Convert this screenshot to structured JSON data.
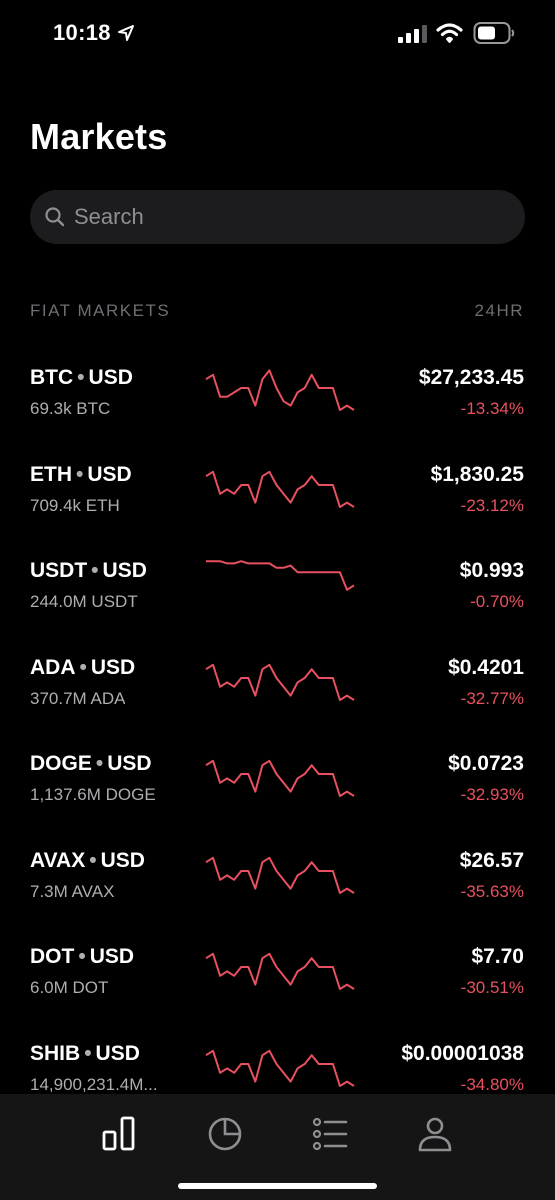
{
  "status_bar": {
    "time": "10:18"
  },
  "page": {
    "title": "Markets"
  },
  "search": {
    "placeholder": "Search"
  },
  "section": {
    "label": "FIAT MARKETS",
    "period": "24HR"
  },
  "colors": {
    "negative": "#e8515f",
    "background": "#000000",
    "tab_bar": "#151515"
  },
  "markets": [
    {
      "base": "BTC",
      "quote": "USD",
      "volume": "69.3k BTC",
      "price": "$27,233.45",
      "change": "-13.34%",
      "trend": [
        0.3,
        0.2,
        0.7,
        0.7,
        0.6,
        0.5,
        0.5,
        0.9,
        0.3,
        0.1,
        0.5,
        0.8,
        0.9,
        0.6,
        0.5,
        0.2,
        0.5,
        0.5,
        0.5,
        1,
        0.9,
        1
      ]
    },
    {
      "base": "ETH",
      "quote": "USD",
      "volume": "709.4k ETH",
      "price": "$1,830.25",
      "change": "-23.12%",
      "trend": [
        0.3,
        0.2,
        0.7,
        0.6,
        0.7,
        0.5,
        0.5,
        0.9,
        0.3,
        0.2,
        0.5,
        0.7,
        0.9,
        0.6,
        0.5,
        0.3,
        0.5,
        0.5,
        0.5,
        1,
        0.9,
        1
      ]
    },
    {
      "base": "USDT",
      "quote": "USD",
      "volume": "244.0M USDT",
      "price": "$0.993",
      "change": "-0.70%",
      "trend": [
        0.05,
        0.05,
        0.05,
        0.1,
        0.1,
        0.05,
        0.1,
        0.1,
        0.1,
        0.1,
        0.2,
        0.2,
        0.15,
        0.3,
        0.3,
        0.3,
        0.3,
        0.3,
        0.3,
        0.3,
        0.7,
        0.6
      ]
    },
    {
      "base": "ADA",
      "quote": "USD",
      "volume": "370.7M ADA",
      "price": "$0.4201",
      "change": "-32.77%",
      "trend": [
        0.3,
        0.2,
        0.7,
        0.6,
        0.7,
        0.5,
        0.5,
        0.9,
        0.3,
        0.2,
        0.5,
        0.7,
        0.9,
        0.6,
        0.5,
        0.3,
        0.5,
        0.5,
        0.5,
        1,
        0.9,
        1
      ]
    },
    {
      "base": "DOGE",
      "quote": "USD",
      "volume": "1,137.6M DOGE",
      "price": "$0.0723",
      "change": "-32.93%",
      "trend": [
        0.3,
        0.2,
        0.7,
        0.6,
        0.7,
        0.5,
        0.5,
        0.9,
        0.3,
        0.2,
        0.5,
        0.7,
        0.9,
        0.6,
        0.5,
        0.3,
        0.5,
        0.5,
        0.5,
        1,
        0.9,
        1
      ]
    },
    {
      "base": "AVAX",
      "quote": "USD",
      "volume": "7.3M AVAX",
      "price": "$26.57",
      "change": "-35.63%",
      "trend": [
        0.3,
        0.2,
        0.7,
        0.6,
        0.7,
        0.5,
        0.5,
        0.9,
        0.3,
        0.2,
        0.5,
        0.7,
        0.9,
        0.6,
        0.5,
        0.3,
        0.5,
        0.5,
        0.5,
        1,
        0.9,
        1
      ]
    },
    {
      "base": "DOT",
      "quote": "USD",
      "volume": "6.0M DOT",
      "price": "$7.70",
      "change": "-30.51%",
      "trend": [
        0.3,
        0.2,
        0.7,
        0.6,
        0.7,
        0.5,
        0.5,
        0.9,
        0.3,
        0.2,
        0.5,
        0.7,
        0.9,
        0.6,
        0.5,
        0.3,
        0.5,
        0.5,
        0.5,
        1,
        0.9,
        1
      ]
    },
    {
      "base": "SHIB",
      "quote": "USD",
      "volume": "14,900,231.4M...",
      "price": "$0.00001038",
      "change": "-34.80%",
      "trend": [
        0.3,
        0.2,
        0.7,
        0.6,
        0.7,
        0.5,
        0.5,
        0.9,
        0.3,
        0.2,
        0.5,
        0.7,
        0.9,
        0.6,
        0.5,
        0.3,
        0.5,
        0.5,
        0.5,
        1,
        0.9,
        1
      ]
    }
  ],
  "tabs": [
    {
      "icon": "bar-chart-icon",
      "active": true
    },
    {
      "icon": "pie-chart-icon",
      "active": false
    },
    {
      "icon": "list-icon",
      "active": false
    },
    {
      "icon": "profile-icon",
      "active": false
    }
  ]
}
